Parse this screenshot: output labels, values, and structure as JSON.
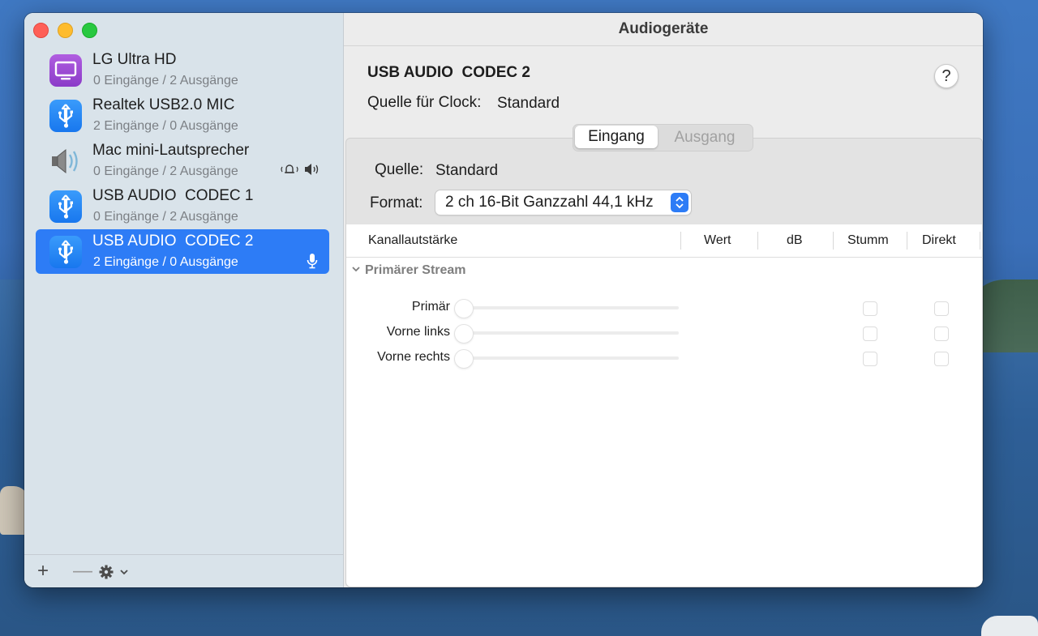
{
  "window": {
    "title": "Audiogeräte"
  },
  "sidebar": {
    "devices": [
      {
        "name": "LG Ultra HD",
        "io": "0 Eingänge / 2 Ausgänge",
        "icon": "display-icon"
      },
      {
        "name": "Realtek USB2.0 MIC",
        "io": "2 Eingänge / 0 Ausgänge",
        "icon": "usb-icon"
      },
      {
        "name": "Mac mini-Lautsprecher",
        "io": "0 Eingänge / 2 Ausgänge",
        "icon": "speaker-icon",
        "badges": [
          "bell-icon",
          "speaker-output-icon"
        ]
      },
      {
        "name": "USB AUDIO  CODEC 1",
        "io": "0 Eingänge / 2 Ausgänge",
        "icon": "usb-icon"
      },
      {
        "name": "USB AUDIO  CODEC 2",
        "io": "2 Eingänge / 0 Ausgänge",
        "icon": "usb-icon",
        "selected": true,
        "badges": [
          "microphone-icon"
        ]
      }
    ],
    "footer": {
      "add": "+",
      "remove": "—",
      "settings": "gear-icon"
    }
  },
  "detail": {
    "device_title": "USB AUDIO  CODEC 2",
    "clock_label": "Quelle für Clock:",
    "clock_value": "Standard",
    "tabs": [
      "Eingang",
      "Ausgang"
    ],
    "active_tab": "Eingang",
    "source_label": "Quelle:",
    "source_value": "Standard",
    "format_label": "Format:",
    "format_value": "2 ch 16-Bit Ganzzahl 44,1 kHz",
    "table": {
      "columns": [
        "Kanallautstärke",
        "Wert",
        "dB",
        "Stumm",
        "Direkt"
      ],
      "group": "Primärer Stream",
      "channels": [
        "Primär",
        "Vorne links",
        "Vorne rechts"
      ]
    }
  },
  "colors": {
    "accent": "#2d7cf6",
    "sidebar_bg": "#d9e3ea"
  }
}
